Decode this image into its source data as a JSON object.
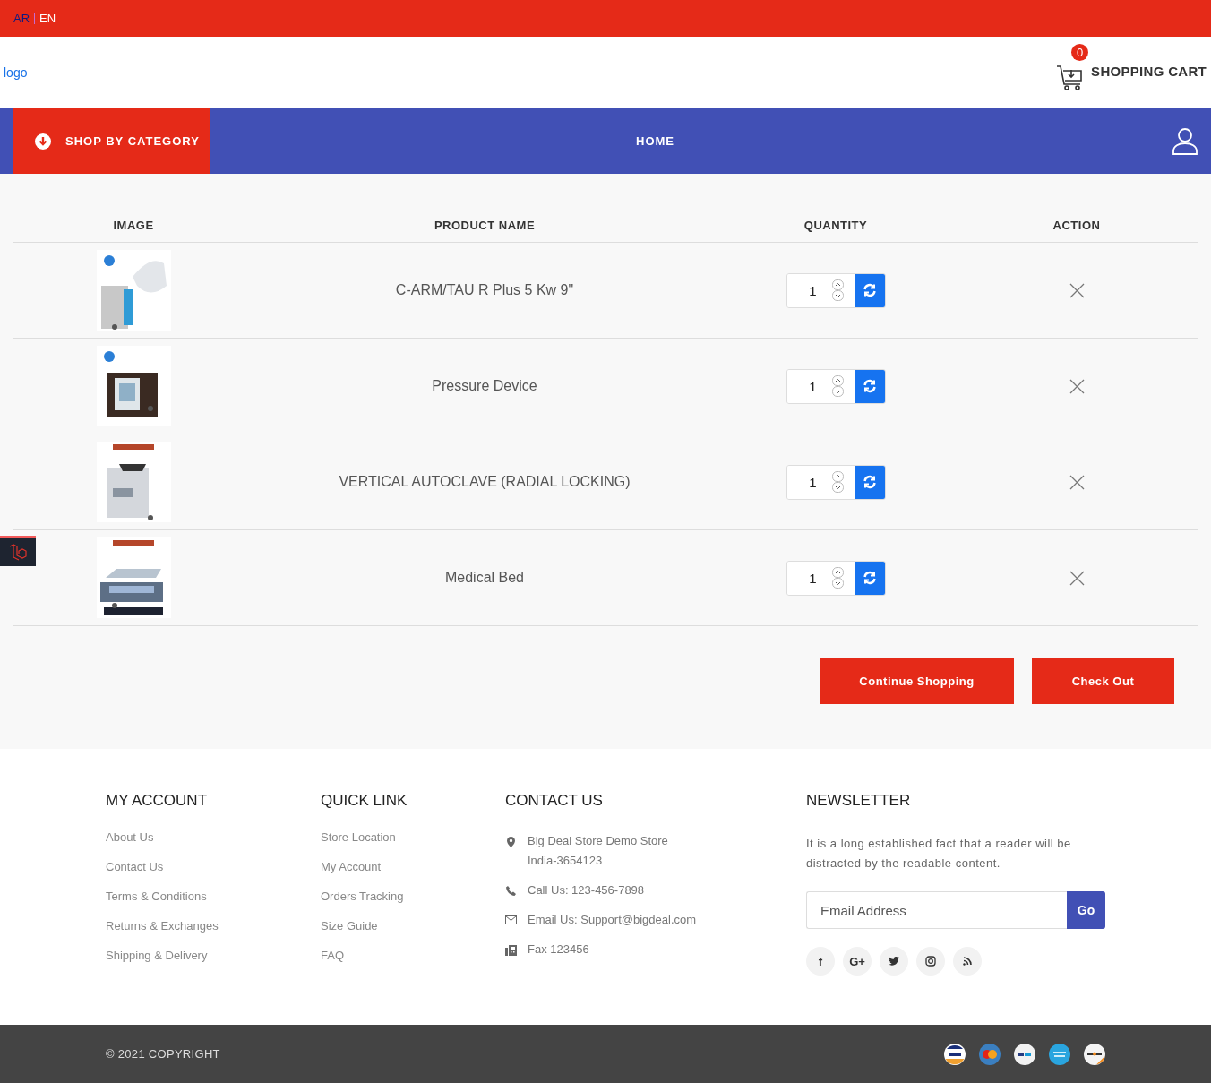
{
  "top_bar": {
    "languages": [
      {
        "label": "AR",
        "selected": false
      },
      {
        "label": "EN",
        "selected": true
      }
    ]
  },
  "header": {
    "logo": "logo",
    "cart": {
      "count": "0",
      "label": "SHOPPING CART"
    }
  },
  "nav": {
    "category_button": "SHOP BY CATEGORY",
    "items": [
      {
        "label": "HOME"
      }
    ]
  },
  "cart_table": {
    "columns": [
      "IMAGE",
      "PRODUCT NAME",
      "QUANTITY",
      "ACTION"
    ],
    "rows": [
      {
        "name": "C-ARM/TAU R Plus 5 Kw 9\"",
        "quantity": "1"
      },
      {
        "name": "Pressure Device",
        "quantity": "1"
      },
      {
        "name": "VERTICAL AUTOCLAVE (RADIAL LOCKING)",
        "quantity": "1"
      },
      {
        "name": "Medical Bed",
        "quantity": "1"
      }
    ]
  },
  "actions": [
    "Continue Shopping",
    "Check Out"
  ],
  "footer": {
    "my_account": {
      "title": "MY ACCOUNT",
      "links": [
        "About Us",
        "Contact Us",
        "Terms & Conditions",
        "Returns & Exchanges",
        "Shipping & Delivery"
      ]
    },
    "quick_link": {
      "title": "QUICK LINK",
      "links": [
        "Store Location",
        "My Account",
        "Orders Tracking",
        "Size Guide",
        "FAQ"
      ]
    },
    "contact_us": {
      "title": "CONTACT US",
      "items": [
        {
          "kind": "location",
          "lines": [
            "Big Deal Store Demo Store",
            "India-3654123"
          ]
        },
        {
          "kind": "phone",
          "lines": [
            "Call Us: 123-456-7898"
          ]
        },
        {
          "kind": "email",
          "lines": [
            "Email Us: Support@bigdeal.com"
          ]
        },
        {
          "kind": "fax",
          "lines": [
            "Fax 123456"
          ]
        }
      ]
    },
    "newsletter": {
      "title": "NEWSLETTER",
      "text": "It is a long established fact that a reader will be distracted by the readable content.",
      "placeholder": "Email Address",
      "button": "Go",
      "social": [
        {
          "kind": "facebook",
          "glyph": "f"
        },
        {
          "kind": "google",
          "glyph": "G+"
        },
        {
          "kind": "twitter"
        },
        {
          "kind": "instagram"
        },
        {
          "kind": "rss"
        }
      ]
    }
  },
  "bottom_bar": {
    "copyright": "© 2021 COPYRIGHT",
    "payment_methods": [
      {
        "kind": "visa"
      },
      {
        "kind": "mastercard"
      },
      {
        "kind": "paypal"
      },
      {
        "kind": "amex"
      },
      {
        "kind": "discover"
      }
    ]
  }
}
